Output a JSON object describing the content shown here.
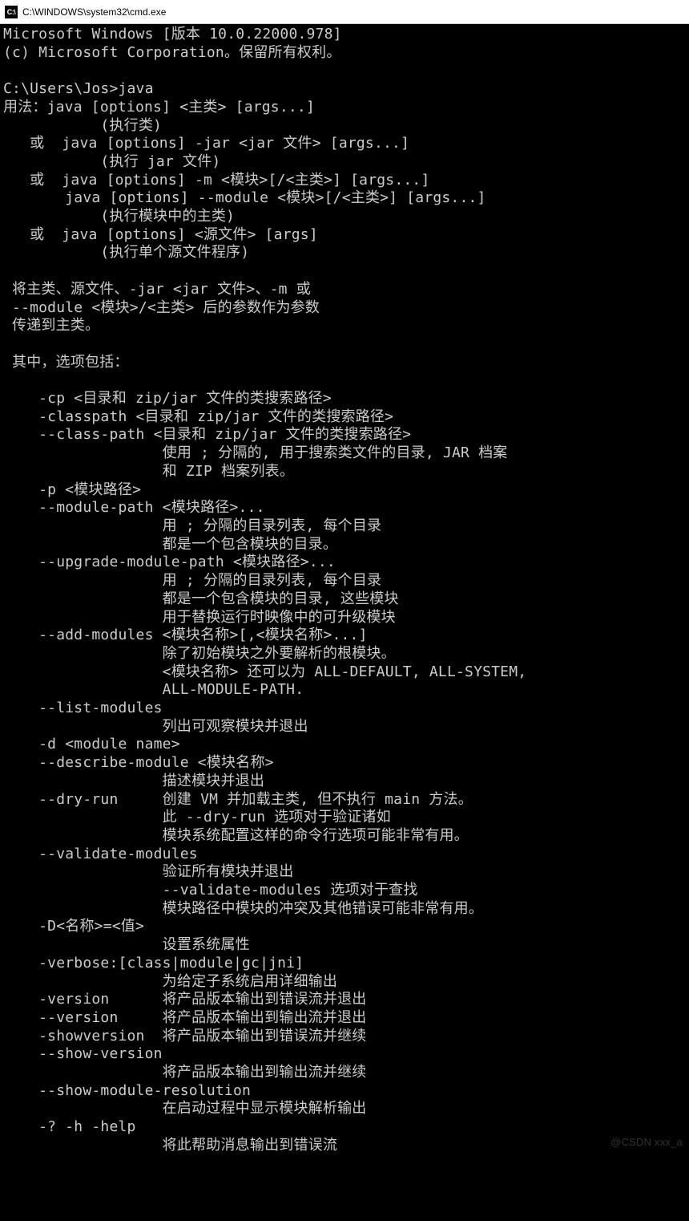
{
  "titlebar": {
    "icon_label": "C:\\",
    "title": "C:\\WINDOWS\\system32\\cmd.exe"
  },
  "terminal": {
    "lines": [
      "Microsoft Windows [版本 10.0.22000.978]",
      "(c) Microsoft Corporation。保留所有权利。",
      "",
      "C:\\Users\\Jos>java",
      "用法：java [options] <主类> [args...]",
      "           (执行类)",
      "   或  java [options] -jar <jar 文件> [args...]",
      "           (执行 jar 文件)",
      "   或  java [options] -m <模块>[/<主类>] [args...]",
      "       java [options] --module <模块>[/<主类>] [args...]",
      "           (执行模块中的主类)",
      "   或  java [options] <源文件> [args]",
      "           (执行单个源文件程序)",
      "",
      " 将主类、源文件、-jar <jar 文件>、-m 或",
      " --module <模块>/<主类> 后的参数作为参数",
      " 传递到主类。",
      "",
      " 其中，选项包括：",
      "",
      "    -cp <目录和 zip/jar 文件的类搜索路径>",
      "    -classpath <目录和 zip/jar 文件的类搜索路径>",
      "    --class-path <目录和 zip/jar 文件的类搜索路径>",
      "                  使用 ; 分隔的, 用于搜索类文件的目录, JAR 档案",
      "                  和 ZIP 档案列表。",
      "    -p <模块路径>",
      "    --module-path <模块路径>...",
      "                  用 ; 分隔的目录列表, 每个目录",
      "                  都是一个包含模块的目录。",
      "    --upgrade-module-path <模块路径>...",
      "                  用 ; 分隔的目录列表, 每个目录",
      "                  都是一个包含模块的目录, 这些模块",
      "                  用于替换运行时映像中的可升级模块",
      "    --add-modules <模块名称>[,<模块名称>...]",
      "                  除了初始模块之外要解析的根模块。",
      "                  <模块名称> 还可以为 ALL-DEFAULT, ALL-SYSTEM,",
      "                  ALL-MODULE-PATH.",
      "    --list-modules",
      "                  列出可观察模块并退出",
      "    -d <module name>",
      "    --describe-module <模块名称>",
      "                  描述模块并退出",
      "    --dry-run     创建 VM 并加载主类, 但不执行 main 方法。",
      "                  此 --dry-run 选项对于验证诸如",
      "                  模块系统配置这样的命令行选项可能非常有用。",
      "    --validate-modules",
      "                  验证所有模块并退出",
      "                  --validate-modules 选项对于查找",
      "                  模块路径中模块的冲突及其他错误可能非常有用。",
      "    -D<名称>=<值>",
      "                  设置系统属性",
      "    -verbose:[class|module|gc|jni]",
      "                  为给定子系统启用详细输出",
      "    -version      将产品版本输出到错误流并退出",
      "    --version     将产品版本输出到输出流并退出",
      "    -showversion  将产品版本输出到错误流并继续",
      "    --show-version",
      "                  将产品版本输出到输出流并继续",
      "    --show-module-resolution",
      "                  在启动过程中显示模块解析输出",
      "    -? -h -help",
      "                  将此帮助消息输出到错误流"
    ]
  },
  "watermark": "@CSDN xxx_a"
}
